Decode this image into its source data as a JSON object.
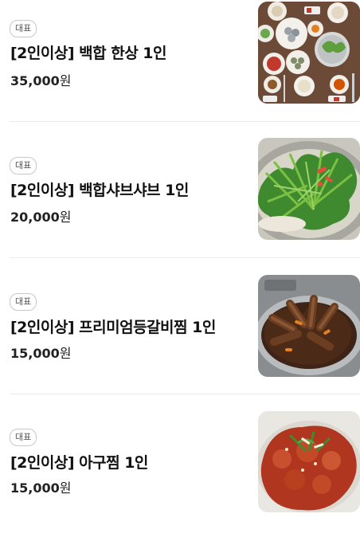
{
  "menu": {
    "items": [
      {
        "badge": "대표",
        "name": "[2인이상] 백합 한상 1인",
        "price": "35,000",
        "unit": "원",
        "image": "table-spread-photo"
      },
      {
        "badge": "대표",
        "name": "[2인이상] 백합샤브샤브 1인",
        "price": "20,000",
        "unit": "원",
        "image": "shabu-hotpot-photo"
      },
      {
        "badge": "대표",
        "name": "[2인이상] 프리미엄등갈비찜 1인",
        "price": "15,000",
        "unit": "원",
        "image": "braised-ribs-photo"
      },
      {
        "badge": "대표",
        "name": "[2인이상] 아구찜 1인",
        "price": "15,000",
        "unit": "원",
        "image": "spicy-monkfish-photo"
      }
    ]
  }
}
